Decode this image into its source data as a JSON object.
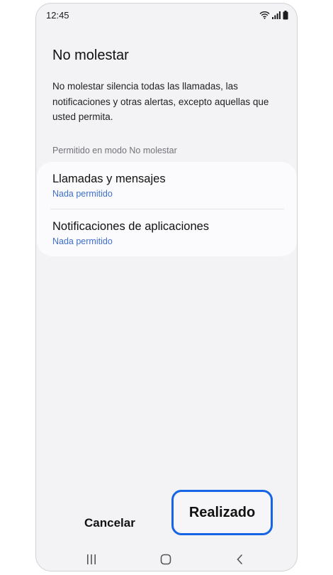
{
  "status_bar": {
    "time": "12:45",
    "icons": [
      "wifi-icon",
      "signal-icon",
      "battery-icon"
    ]
  },
  "page": {
    "title": "No molestar",
    "description": "No molestar silencia todas las llamadas, las notificaciones y otras alertas, excepto aquellas que usted permita.",
    "section_label": "Permitido en modo No molestar"
  },
  "settings": [
    {
      "title": "Llamadas y mensajes",
      "subtitle": "Nada permitido"
    },
    {
      "title": "Notificaciones de aplicaciones",
      "subtitle": "Nada permitido"
    }
  ],
  "actions": {
    "cancel_label": "Cancelar",
    "done_label": "Realizado"
  },
  "colors": {
    "accent": "#1565e6",
    "subtitle": "#3e6fcf",
    "background": "#f3f3f6"
  },
  "navigation": [
    "recent-apps-icon",
    "home-icon",
    "back-icon"
  ]
}
